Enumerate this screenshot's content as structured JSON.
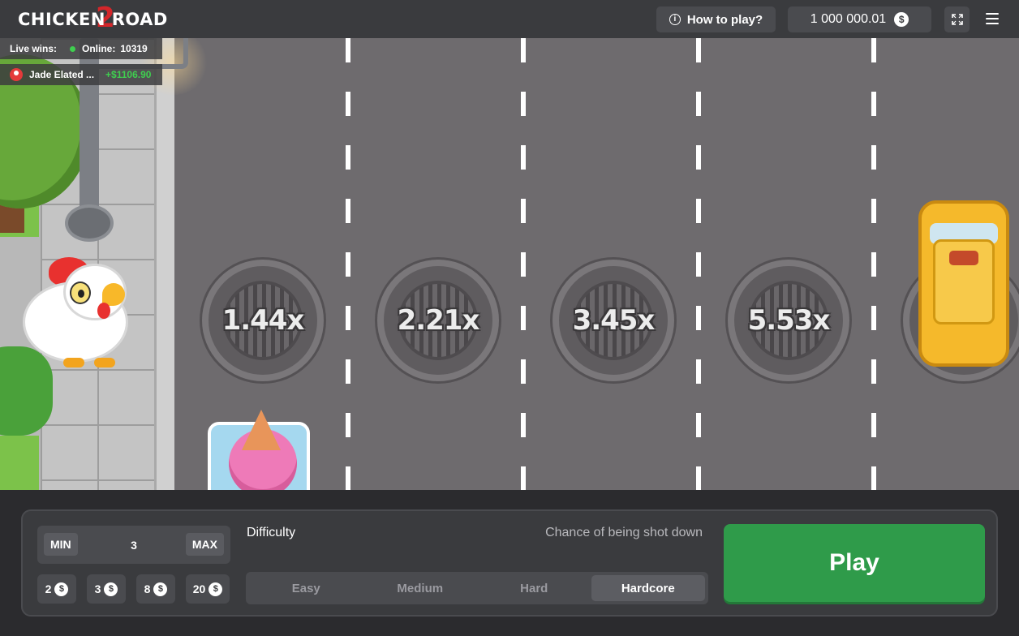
{
  "header": {
    "logo_main": "CHICKEN ROAD",
    "logo_number": "2",
    "how_to_play": "How to play?",
    "info_icon": "i",
    "balance": "1 000 000.01",
    "currency_symbol": "$"
  },
  "live": {
    "label": "Live wins:",
    "online_label": "Online:",
    "online_count": "10319",
    "latest_winner": "Jade Elated ...",
    "latest_amount": "+$1106.90"
  },
  "multipliers": [
    "1.44x",
    "2.21x",
    "3.45x",
    "5.53x"
  ],
  "bet": {
    "min_label": "MIN",
    "max_label": "MAX",
    "value": "3",
    "quick_amounts": [
      "2",
      "3",
      "8",
      "20"
    ]
  },
  "difficulty": {
    "label": "Difficulty",
    "chance_label": "Chance of being shot down",
    "options": [
      "Easy",
      "Medium",
      "Hard",
      "Hardcore"
    ],
    "selected": "Hardcore"
  },
  "play_label": "Play",
  "colors": {
    "accent_green": "#2f9b4a",
    "win_green": "#3fcf4f",
    "logo_red": "#d4262a"
  }
}
